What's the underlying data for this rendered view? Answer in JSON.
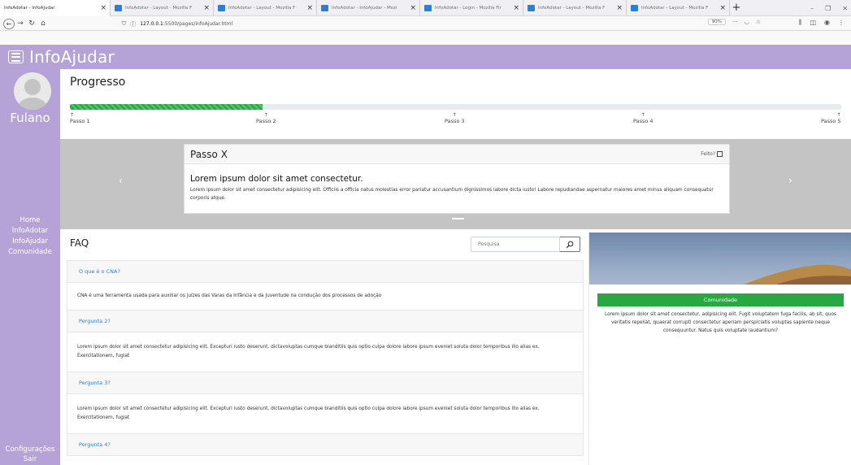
{
  "browser": {
    "tabs": [
      {
        "title": "InfoAdotar - InfoAjudar"
      },
      {
        "title": "InfoAdotar - Layout - Mozilla F"
      },
      {
        "title": "InfoAdotar - Layout - Mozilla F"
      },
      {
        "title": "InfoAdotar - InfoAjudar - Mozi"
      },
      {
        "title": "InfoAdotar - Login - Mozilla Fir"
      },
      {
        "title": "InfoAdotar - Layout - Mozilla F"
      },
      {
        "title": "InfoAdotar - Layout - Mozilla F"
      }
    ],
    "url_host": "127.0.0.1",
    "url_rest": ":5500/pages/infoAjudar.html",
    "zoom": "90%"
  },
  "app": {
    "brand": "InfoAjudar",
    "accent_color": "#b5a3d8"
  },
  "sidebar": {
    "username": "Fulano",
    "links": [
      "Home",
      "InfoAdotar",
      "InfoAjudar",
      "Comunidade"
    ],
    "bottom_links": [
      "Configurações",
      "Sair"
    ]
  },
  "progress": {
    "title": "Progresso",
    "value_percent": 25,
    "bar_color": "#28a745",
    "steps": [
      "Passo 1",
      "Passo 2",
      "Passo 3",
      "Passo 4",
      "Passo 5"
    ]
  },
  "carousel": {
    "prev": "‹",
    "next": "›",
    "card": {
      "title": "Passo X",
      "done_label": "Feito?",
      "lead": "Lorem ipsum dolor sit amet consectetur.",
      "text": "Lorem ipsum dolor sit amet consectetur adipisicing elit. Officiis a officia natus molestias error pariatur accusantium dignissimos labore dicta iusto! Labore repudiandae aspernatur maiores amet minus aliquam consequatur corporis atque."
    }
  },
  "faq": {
    "title": "FAQ",
    "search_placeholder": "Pesquisa",
    "items": [
      {
        "question": "O que é o CNA?",
        "answer": "CNA é uma ferramenta usada para auxiliar os juízes das Varas da Infância e da Juventude na condução dos processos de adoção"
      },
      {
        "question": "Pergunta 2?",
        "answer": "Lorem ipsum dolor sit amet consectetur adipisicing elit. Excepturi iusto deserunt, dictavoluptas cumque blanditiis quis optio culpa dolore labore ipsum eveniet soluta dolor temporibus illo alias ex. Exercitationem, fugiat"
      },
      {
        "question": "Pergunta 3?",
        "answer": "Lorem ipsum dolor sit amet consectetur adipisicing elit. Excepturi iusto deserunt, dictavoluptas cumque blanditiis quis optio culpa dolore labore ipsum eveniet soluta dolor temporibus illo alias ex. Exercitationem, fugiat"
      },
      {
        "question": "Pergunta 4?"
      }
    ]
  },
  "community": {
    "button_label": "Comunidade",
    "button_color": "#28a745",
    "text": "Lorem ipsum dolor sit amet consectetur, adipisicing elit. Fugit voluptatem fuga facilis, ab sit, quos veritatis repellat, quaerat corrupti consectetur aperiam perspiciatis voluptas sapiente neque consequuntur. Natus quis voluptate laudantium?"
  }
}
